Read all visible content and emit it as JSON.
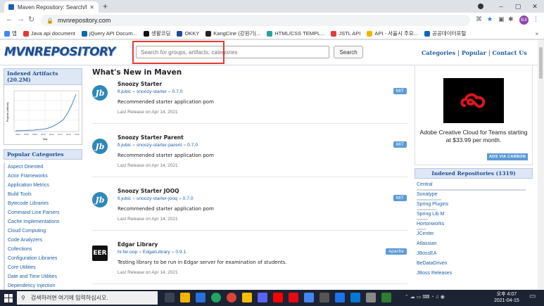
{
  "browser": {
    "tab_title": "Maven Repository: Search/Brow",
    "close_glyph": "✕",
    "new_tab_glyph": "+",
    "back_glyph": "←",
    "forward_glyph": "→",
    "reload_glyph": "↻",
    "url": "mvnrepository.com",
    "avatar_initials": "BJI",
    "window_controls": [
      "–",
      "▢",
      "✕"
    ],
    "bookmarks": [
      {
        "label": "앱",
        "color": "#4285f4"
      },
      {
        "label": "Java api document",
        "color": "#e53935"
      },
      {
        "label": "jQuery API Docum...",
        "color": "#0769ad"
      },
      {
        "label": "생활코딩",
        "color": "#111111"
      },
      {
        "label": "OKKY",
        "color": "#1f4c8f"
      },
      {
        "label": "KangCine (강원기(...",
        "color": "#222222"
      },
      {
        "label": "HTML/CSS TEMPL...",
        "color": "#26a69a"
      },
      {
        "label": "JSTL API",
        "color": "#e53935"
      },
      {
        "label": "API - 서울시 주요...",
        "color": "#f4b400"
      },
      {
        "label": "공공데이터포털",
        "color": "#1565c0"
      }
    ],
    "bookmarks_more": "»"
  },
  "header": {
    "logo": "MVNREPOSITORY",
    "search_placeholder": "Search for groups, artifacts, categories",
    "search_button": "Search",
    "links": [
      "Categories",
      "Popular",
      "Contact Us"
    ],
    "sep": "|"
  },
  "left": {
    "indexed_title": "Indexed Artifacts (20.2M)",
    "chart_ylabel": "Projects (millions)",
    "chart_xlabel": "Year",
    "chart_xticks": [
      "2004",
      "2006",
      "2008",
      "2010",
      "2012",
      "2014",
      "2016",
      "2018"
    ],
    "categories_title": "Popular Categories",
    "categories": [
      "Aspect Oriented",
      "Actor Frameworks",
      "Application Metrics",
      "Build Tools",
      "Bytecode Libraries",
      "Command Line Parsers",
      "Cache Implementations",
      "Cloud Computing",
      "Code Analyzers",
      "Collections",
      "Configuration Libraries",
      "Core Utilities",
      "Date and Time Utilities",
      "Dependency Injection",
      "Embedded SQL Databases"
    ]
  },
  "main": {
    "heading": "What's New in Maven",
    "coord_sep": "»",
    "entries": [
      {
        "icon": "Jb",
        "name": "Snoozy Starter",
        "group": "fi.jubic",
        "artifact": "snoozy-starter",
        "version": "0.7.0",
        "desc": "Recommended starter application pom",
        "release": "Last Release on Apr 14, 2021",
        "license": "MIT"
      },
      {
        "icon": "Jb",
        "name": "Snoozy Starter Parent",
        "group": "fi.jubic",
        "artifact": "snoozy-starter-parent",
        "version": "0.7.0",
        "desc": "Recommended starter application pom",
        "release": "Last Release on Apr 14, 2021",
        "license": "MIT"
      },
      {
        "icon": "Jb",
        "name": "Snoozy Starter JOOQ",
        "group": "fi.jubic",
        "artifact": "snoozy-starter-jooq",
        "version": "0.7.0",
        "desc": "Recommended starter application pom",
        "release": "Last Release on Apr 14, 2021",
        "license": "MIT"
      },
      {
        "icon": "EER",
        "name": "Edgar Library",
        "group": "hr.fer.oop",
        "artifact": "EdgarLibrary",
        "version": "0.9.1",
        "desc": "Testing library to be run in Edgar server for examination of students.",
        "release": "Last Release on Apr 14, 2021",
        "license": "Apache"
      }
    ]
  },
  "right": {
    "ad_text": "Adobe Creative Cloud for Teams starting at $33.99 per month.",
    "ad_via": "ADS VIA CARBON",
    "repos_title": "Indexed Repositories (1319)",
    "repos": [
      {
        "name": "Central",
        "fill": 0.98
      },
      {
        "name": "Sonatype",
        "fill": 0.22
      },
      {
        "name": "Spring Plugins",
        "fill": 0.18
      },
      {
        "name": "Spring Lib M",
        "fill": 0.1
      },
      {
        "name": "Hortonworks",
        "fill": 0.08
      },
      {
        "name": "JCenter",
        "fill": 0.0
      },
      {
        "name": "Atlassian",
        "fill": 0.0
      },
      {
        "name": "JBossEA",
        "fill": 0.0
      },
      {
        "name": "BeDataDriven",
        "fill": 0.0
      },
      {
        "name": "JBoss Releases",
        "fill": 0.0
      }
    ]
  },
  "taskbar": {
    "search_placeholder": "검색하려면 여기에 입력하십시오.",
    "time": "오후 4:07",
    "date": "2021-04-15"
  }
}
